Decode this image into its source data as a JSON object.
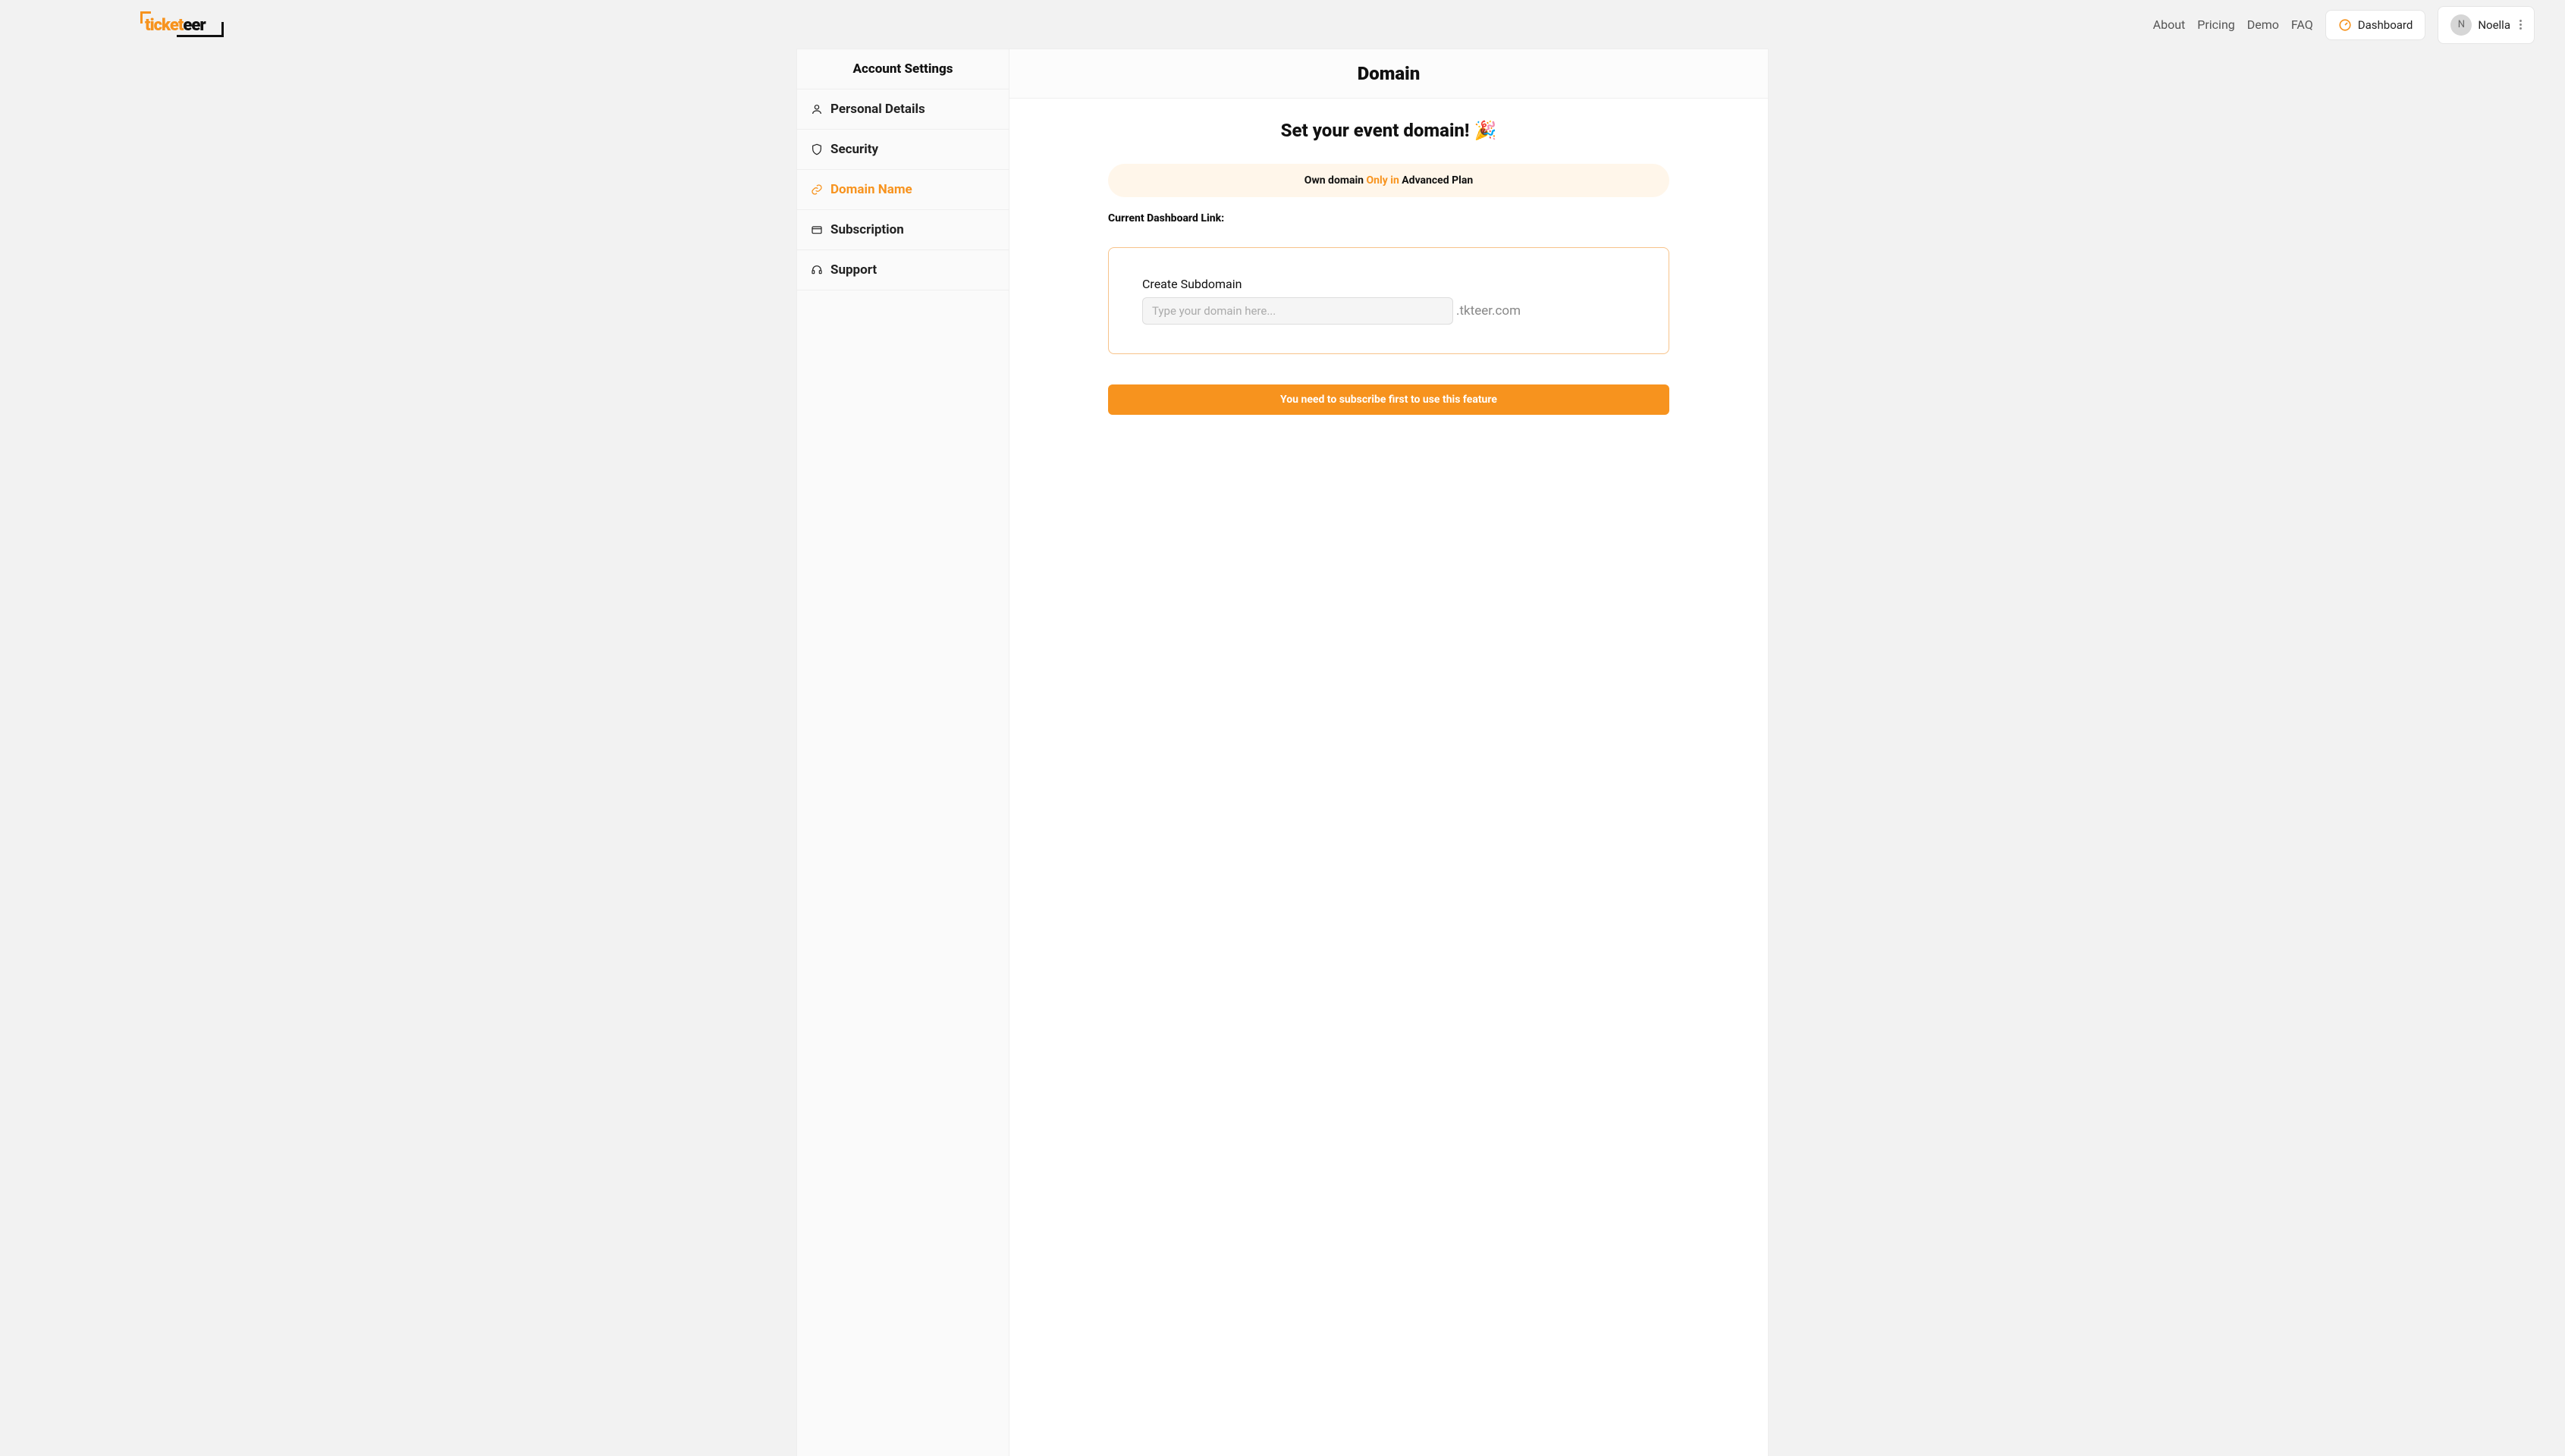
{
  "brand": {
    "part1": "ticket",
    "part2": "eer"
  },
  "nav": {
    "about": "About",
    "pricing": "Pricing",
    "demo": "Demo",
    "faq": "FAQ",
    "dashboard": "Dashboard"
  },
  "user": {
    "initial": "N",
    "name": "Noella"
  },
  "sidebar": {
    "title": "Account Settings",
    "items": [
      {
        "label": "Personal Details"
      },
      {
        "label": "Security"
      },
      {
        "label": "Domain Name"
      },
      {
        "label": "Subscription"
      },
      {
        "label": "Support"
      }
    ]
  },
  "page": {
    "title": "Domain",
    "hero": "Set your event domain! 🎉",
    "banner_pre": "Own domain ",
    "banner_orange": "Only in",
    "banner_post": " Advanced Plan",
    "current_link_label": "Current Dashboard Link:",
    "field_label": "Create Subdomain",
    "placeholder": "Type your domain here...",
    "suffix": ".tkteer.com",
    "cta": "You need to subscribe first to use this feature"
  }
}
